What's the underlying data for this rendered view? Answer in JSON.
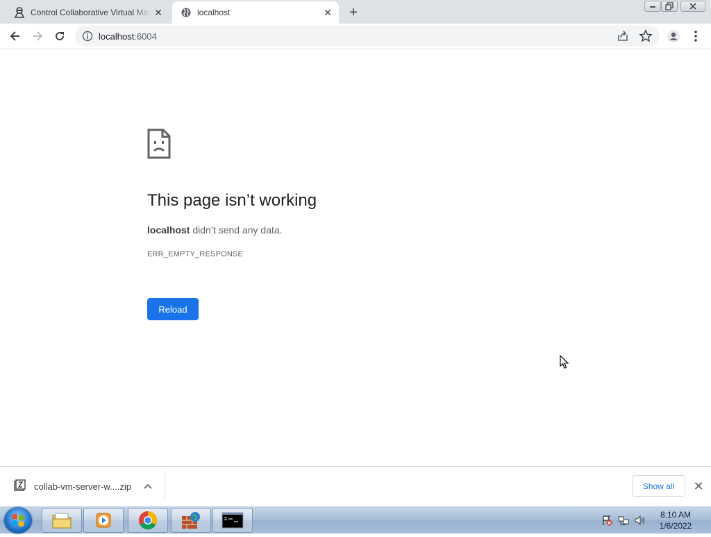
{
  "browser": {
    "tabs": [
      {
        "title": "Control Collaborative Virtual Machine",
        "favicon": "vm-agent-icon",
        "active": false
      },
      {
        "title": "localhost",
        "favicon": "globe-icon",
        "active": true
      }
    ],
    "new_tab_label": "+",
    "close_glyph": "✕",
    "address": {
      "host": "localhost",
      "port": ":6004"
    }
  },
  "error_page": {
    "title": "This page isn’t working",
    "host": "localhost",
    "message": " didn’t send any data.",
    "code": "ERR_EMPTY_RESPONSE",
    "reload_label": "Reload"
  },
  "download_shelf": {
    "file_name": "collab-vm-server-w....zip",
    "show_all_label": "Show all"
  },
  "taskbar": {
    "items": [
      "explorer-icon",
      "media-player-icon",
      "chrome-icon",
      "firewall-globe-icon",
      "command-prompt-icon"
    ],
    "clock_time": "8:10 AM",
    "clock_date": "1/6/2022"
  },
  "colors": {
    "accent": "#1a73e8",
    "tabstrip": "#dee1e6",
    "omnibox": "#f1f3f4"
  }
}
